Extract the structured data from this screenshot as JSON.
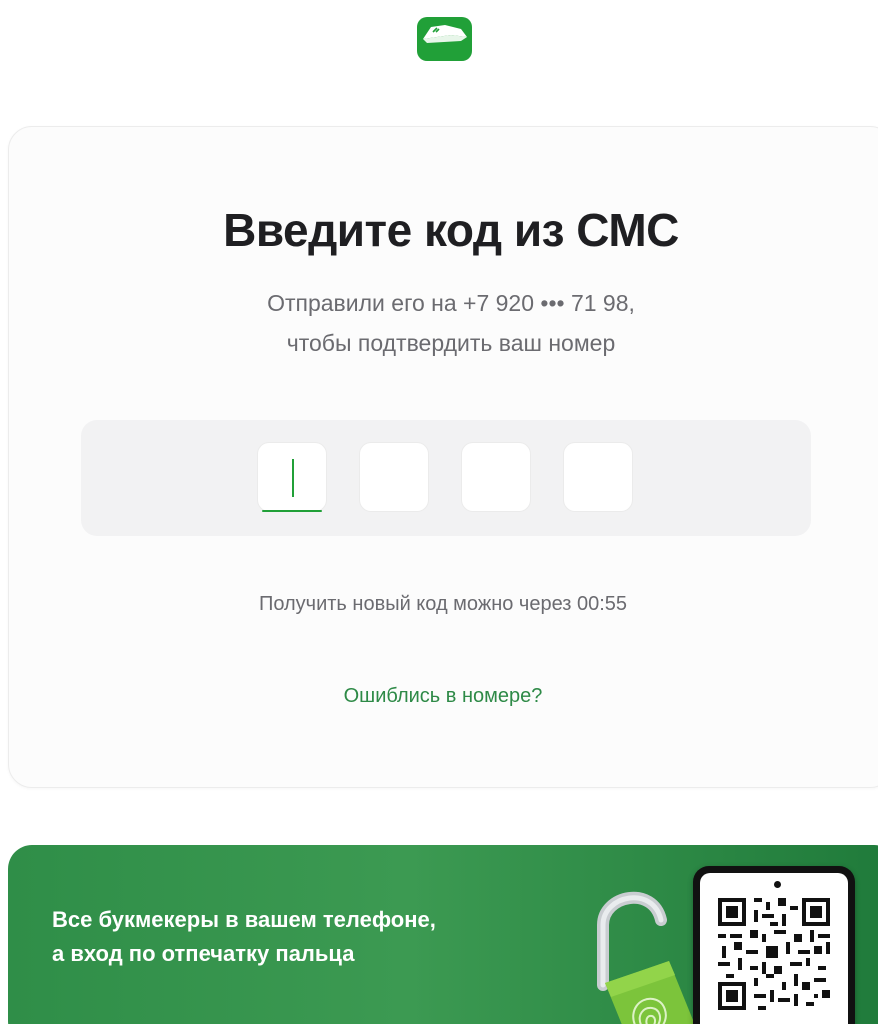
{
  "logo": {
    "icon": "bank-logo-icon",
    "color": "#21a038"
  },
  "verify": {
    "title": "Введите код из СМС",
    "subtitle_line1": "Отправили его на +7 920 ••• 71 98,",
    "subtitle_line2": "чтобы подтвердить ваш номер",
    "code_cells": [
      "",
      "",
      "",
      ""
    ],
    "timer_text": "Получить новый код можно через 00:55",
    "wrong_number_link": "Ошиблись в номере?"
  },
  "banner": {
    "line1": "Все букмекеры в вашем телефоне,",
    "line2": "а вход по отпечатку пальца",
    "icons": [
      "padlock-fingerprint-icon",
      "qr-code-icon"
    ]
  },
  "colors": {
    "accent": "#21a038",
    "link": "#2e8a47",
    "text_primary": "#1f1f22",
    "text_secondary": "#6b6b70"
  }
}
